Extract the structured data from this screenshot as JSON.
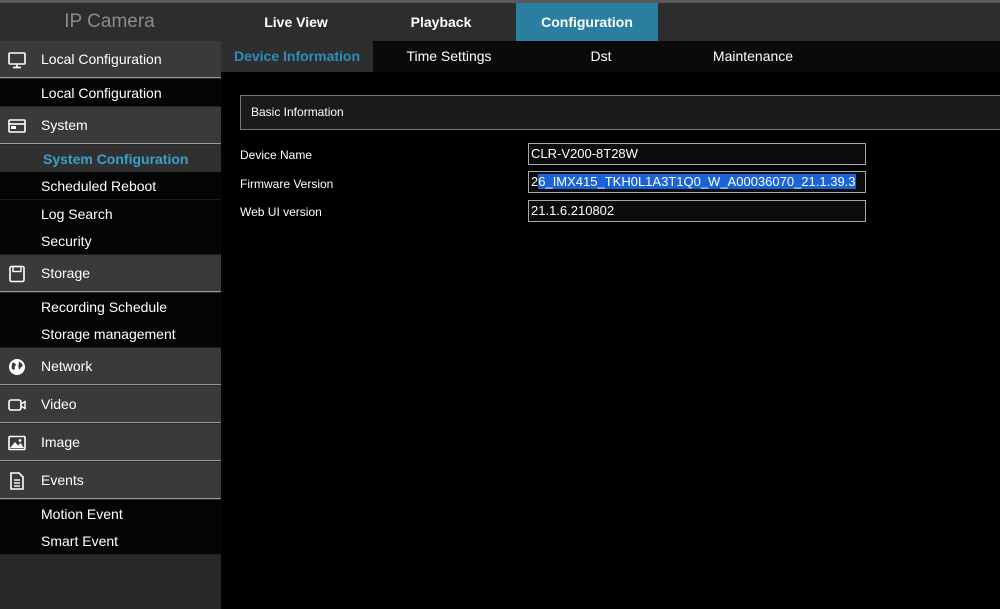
{
  "app": {
    "title": "IP Camera"
  },
  "topnav": {
    "tabs": [
      {
        "label": "Live View"
      },
      {
        "label": "Playback"
      },
      {
        "label": "Configuration"
      }
    ]
  },
  "sidebar": {
    "local_configuration": {
      "label": "Local Configuration",
      "icon": "monitor-icon"
    },
    "local_configuration_sub": {
      "label": "Local Configuration"
    },
    "system": {
      "label": "System",
      "icon": "system-icon"
    },
    "system_configuration": {
      "label": "System Configuration"
    },
    "scheduled_reboot": {
      "label": "Scheduled Reboot"
    },
    "log_search": {
      "label": "Log Search"
    },
    "security": {
      "label": "Security"
    },
    "storage": {
      "label": "Storage",
      "icon": "storage-icon"
    },
    "recording_schedule": {
      "label": "Recording Schedule"
    },
    "storage_management": {
      "label": "Storage management"
    },
    "network": {
      "label": "Network",
      "icon": "globe-icon"
    },
    "video": {
      "label": "Video",
      "icon": "video-camera-icon"
    },
    "image": {
      "label": "Image",
      "icon": "image-icon"
    },
    "events": {
      "label": "Events",
      "icon": "document-icon"
    },
    "motion_event": {
      "label": "Motion Event"
    },
    "smart_event": {
      "label": "Smart Event"
    }
  },
  "subnav": {
    "tabs": [
      {
        "label": "Device Information"
      },
      {
        "label": "Time Settings"
      },
      {
        "label": "Dst"
      },
      {
        "label": "Maintenance"
      }
    ]
  },
  "main": {
    "section_title": "Basic Information",
    "device_name": {
      "label": "Device Name",
      "value": "CLR-V200-8T28W"
    },
    "firmware_version": {
      "label": "Firmware Version",
      "value_prefix": "2",
      "value_selected": "6_IMX415_TKH0L1A3T1Q0_W_A00036070_21.1.39.3"
    },
    "web_ui_version": {
      "label": "Web UI version",
      "value": "21.1.6.210802"
    }
  },
  "colors": {
    "accent": "#2a7fa0",
    "active_text": "#3aa0cc",
    "selection": "#1a63d6"
  }
}
